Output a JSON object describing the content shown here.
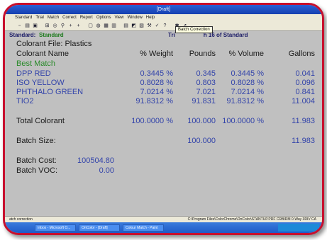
{
  "window": {
    "title": "[Draft]"
  },
  "menu": [
    "Standard",
    "Trial",
    "Match",
    "Correct",
    "Report",
    "Options",
    "View",
    "Window",
    "Help"
  ],
  "toolbar": {
    "icons": [
      "new-icon",
      "open-icon",
      "save-icon",
      "print-icon",
      "measure-icon",
      "search-icon",
      "add-icon",
      "add-icon",
      "delete-icon",
      "chart-icon",
      "grid-icon",
      "list-icon",
      "table-icon",
      "graph-icon",
      "chart-icon",
      "tools-icon",
      "check-icon",
      "help-icon",
      "settings-icon",
      "pointer-icon"
    ],
    "tooltip": "Batch Correction"
  },
  "standard": {
    "label": "Standard:",
    "value": "Standard"
  },
  "trial_info": {
    "prefix": "Tri",
    "suffix": "h 16 of Standard"
  },
  "colorant_file": "Colorant File: Plastics",
  "columns": {
    "name": "Colorant Name",
    "weight": "% Weight",
    "pounds": "Pounds",
    "volume": "% Volume",
    "gallons": "Gallons"
  },
  "best_match": "Best Match",
  "rows": [
    {
      "name": "DPP RED",
      "weight": "0.3445 %",
      "pounds": "0.345",
      "volume": "0.3445 %",
      "gallons": "0.041"
    },
    {
      "name": "ISO YELLOW",
      "weight": "0.8028 %",
      "pounds": "0.803",
      "volume": "0.8028 %",
      "gallons": "0.096"
    },
    {
      "name": "PHTHALO  GREEN",
      "weight": "7.0214 %",
      "pounds": "7.021",
      "volume": "7.0214 %",
      "gallons": "0.841"
    },
    {
      "name": "TIO2",
      "weight": "91.8312 %",
      "pounds": "91.831",
      "volume": "91.8312 %",
      "gallons": "11.004"
    }
  ],
  "total": {
    "label": "Total Colorant",
    "weight": "100.0000 %",
    "pounds": "100.000",
    "volume": "100.0000 %",
    "gallons": "11.983"
  },
  "batch_size": {
    "label": "Batch Size:",
    "pounds": "100.000",
    "gallons": "11.983"
  },
  "batch_cost": {
    "label": "Batch Cost:",
    "value": "100504.80"
  },
  "batch_voc": {
    "label": "Batch VOC:",
    "value": "0.00"
  },
  "status": {
    "left": "atch correction",
    "right": "C:\\Program Files\\ColorChrome\\OnColor\\STANTUP.PRF   CRBIRM  0-Way 3RIV  CA"
  },
  "taskbar": {
    "tasks": [
      "Inbox - Microsoft O...",
      "OnColor - [Draft]",
      "Colour Match - Paint"
    ]
  }
}
